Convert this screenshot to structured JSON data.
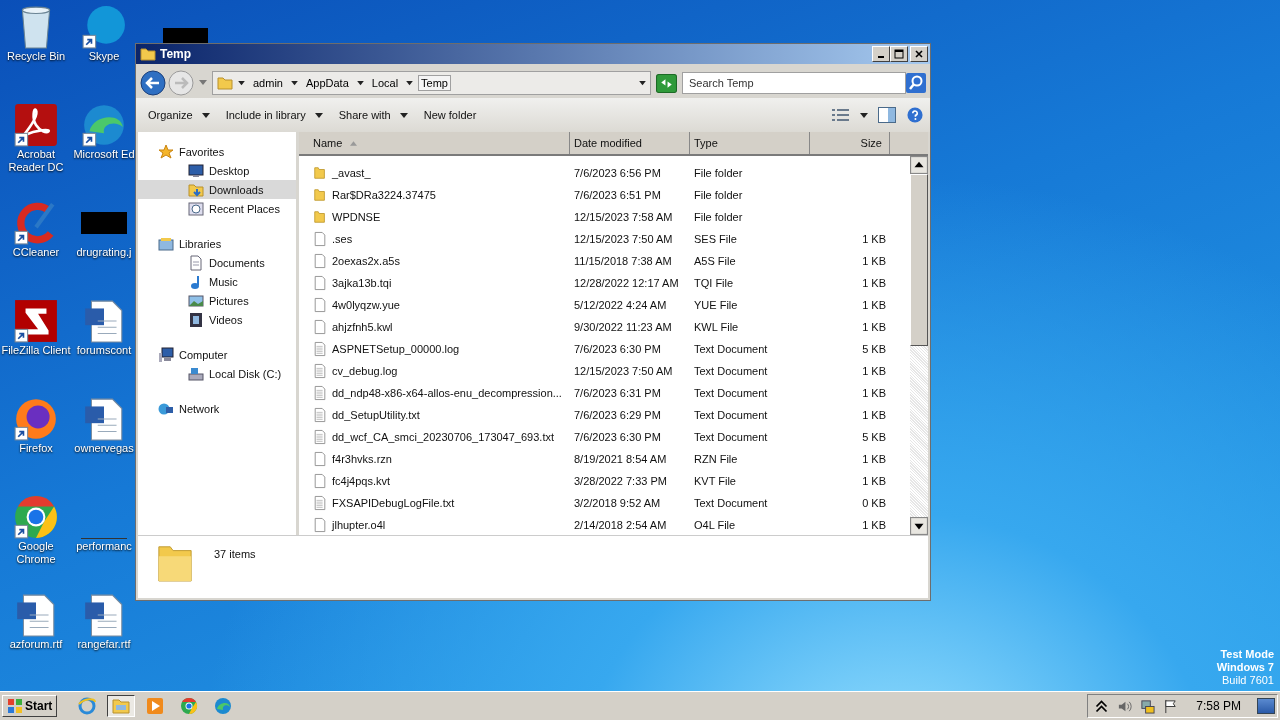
{
  "desktop": {
    "icons": [
      {
        "label": "Recycle Bin",
        "kind": "recycle",
        "shortcut": false
      },
      {
        "label": "Acrobat Reader DC",
        "kind": "acrobat",
        "shortcut": true
      },
      {
        "label": "CCleaner",
        "kind": "ccleaner",
        "shortcut": true
      },
      {
        "label": "FileZilla Client",
        "kind": "filezilla",
        "shortcut": true
      },
      {
        "label": "Firefox",
        "kind": "firefox",
        "shortcut": true
      },
      {
        "label": "Google Chrome",
        "kind": "chrome",
        "shortcut": true
      },
      {
        "label": "azforum.rtf",
        "kind": "word",
        "shortcut": false
      },
      {
        "label": "Skype",
        "kind": "skype",
        "shortcut": true
      },
      {
        "label": "Microsoft Ed",
        "kind": "edge",
        "shortcut": true
      },
      {
        "label": "drugrating.j",
        "kind": "redacted"
      },
      {
        "label": "forumscont",
        "kind": "word",
        "shortcut": false
      },
      {
        "label": "ownervegas",
        "kind": "word",
        "shortcut": false
      },
      {
        "label": "performanc",
        "kind": "blank"
      },
      {
        "label": "rangefar.rtf",
        "kind": "word",
        "shortcut": false
      }
    ],
    "os_notice": [
      "Test Mode",
      "Windows 7",
      "Build 7601"
    ]
  },
  "window": {
    "title": "Temp",
    "breadcrumb": [
      {
        "label": "admin",
        "selected": false
      },
      {
        "label": "AppData",
        "selected": false
      },
      {
        "label": "Local",
        "selected": false
      },
      {
        "label": "Temp",
        "selected": true
      }
    ],
    "search": {
      "placeholder": "Search Temp"
    },
    "toolbar": [
      {
        "label": "Organize",
        "has_menu": true
      },
      {
        "label": "Include in library",
        "has_menu": true
      },
      {
        "label": "Share with",
        "has_menu": true
      },
      {
        "label": "New folder",
        "has_menu": false
      }
    ],
    "sidebar": {
      "groups": [
        {
          "label": "Favorites",
          "kind": "star",
          "children": [
            {
              "label": "Desktop",
              "kind": "desktop",
              "selected": false
            },
            {
              "label": "Downloads",
              "kind": "downloads",
              "selected": true
            },
            {
              "label": "Recent Places",
              "kind": "recent",
              "selected": false
            }
          ]
        },
        {
          "label": "Libraries",
          "kind": "library",
          "children": [
            {
              "label": "Documents",
              "kind": "documents",
              "selected": false
            },
            {
              "label": "Music",
              "kind": "music",
              "selected": false
            },
            {
              "label": "Pictures",
              "kind": "pictures",
              "selected": false
            },
            {
              "label": "Videos",
              "kind": "videos",
              "selected": false
            }
          ]
        },
        {
          "label": "Computer",
          "kind": "computer",
          "children": [
            {
              "label": "Local Disk (C:)",
              "kind": "disk",
              "selected": false
            }
          ]
        },
        {
          "label": "Network",
          "kind": "network"
        }
      ]
    },
    "table": {
      "columns": [
        {
          "label": "Name",
          "sorted": true
        },
        {
          "label": "Date modified",
          "sorted": false
        },
        {
          "label": "Type",
          "sorted": false
        },
        {
          "label": "Size",
          "sorted": false
        }
      ],
      "rows": [
        {
          "name": "_avast_",
          "date": "7/6/2023 6:56 PM",
          "type": "File folder",
          "size": "",
          "kind": "folder"
        },
        {
          "name": "Rar$DRa3224.37475",
          "date": "7/6/2023 6:51 PM",
          "type": "File folder",
          "size": "",
          "kind": "folder"
        },
        {
          "name": "WPDNSE",
          "date": "12/15/2023 7:58 AM",
          "type": "File folder",
          "size": "",
          "kind": "folder"
        },
        {
          "name": ".ses",
          "date": "12/15/2023 7:50 AM",
          "type": "SES File",
          "size": "1 KB",
          "kind": "file"
        },
        {
          "name": "2oexas2x.a5s",
          "date": "11/15/2018 7:38 AM",
          "type": "A5S File",
          "size": "1 KB",
          "kind": "file"
        },
        {
          "name": "3ajka13b.tqi",
          "date": "12/28/2022 12:17 AM",
          "type": "TQI File",
          "size": "1 KB",
          "kind": "file"
        },
        {
          "name": "4w0lyqzw.yue",
          "date": "5/12/2022 4:24 AM",
          "type": "YUE File",
          "size": "1 KB",
          "kind": "file"
        },
        {
          "name": "ahjzfnh5.kwl",
          "date": "9/30/2022 11:23 AM",
          "type": "KWL File",
          "size": "1 KB",
          "kind": "file"
        },
        {
          "name": "ASPNETSetup_00000.log",
          "date": "7/6/2023 6:30 PM",
          "type": "Text Document",
          "size": "5 KB",
          "kind": "text"
        },
        {
          "name": "cv_debug.log",
          "date": "12/15/2023 7:50 AM",
          "type": "Text Document",
          "size": "1 KB",
          "kind": "text"
        },
        {
          "name": "dd_ndp48-x86-x64-allos-enu_decompression...",
          "date": "7/6/2023 6:31 PM",
          "type": "Text Document",
          "size": "1 KB",
          "kind": "text"
        },
        {
          "name": "dd_SetupUtility.txt",
          "date": "7/6/2023 6:29 PM",
          "type": "Text Document",
          "size": "1 KB",
          "kind": "text"
        },
        {
          "name": "dd_wcf_CA_smci_20230706_173047_693.txt",
          "date": "7/6/2023 6:30 PM",
          "type": "Text Document",
          "size": "5 KB",
          "kind": "text"
        },
        {
          "name": "f4r3hvks.rzn",
          "date": "8/19/2021 8:54 AM",
          "type": "RZN File",
          "size": "1 KB",
          "kind": "file"
        },
        {
          "name": "fc4j4pqs.kvt",
          "date": "3/28/2022 7:33 PM",
          "type": "KVT File",
          "size": "1 KB",
          "kind": "file"
        },
        {
          "name": "FXSAPIDebugLogFile.txt",
          "date": "3/2/2018 9:52 AM",
          "type": "Text Document",
          "size": "0 KB",
          "kind": "text"
        },
        {
          "name": "jlhupter.o4l",
          "date": "2/14/2018 2:54 AM",
          "type": "O4L File",
          "size": "1 KB",
          "kind": "file"
        }
      ]
    },
    "status": "37 items"
  },
  "taskbar": {
    "start": "Start",
    "apps": [
      {
        "kind": "ie",
        "active": false
      },
      {
        "kind": "explorer",
        "active": true
      },
      {
        "kind": "media",
        "active": false
      },
      {
        "kind": "chrome",
        "active": false
      },
      {
        "kind": "edge",
        "active": false
      }
    ],
    "time": "7:58 PM"
  }
}
